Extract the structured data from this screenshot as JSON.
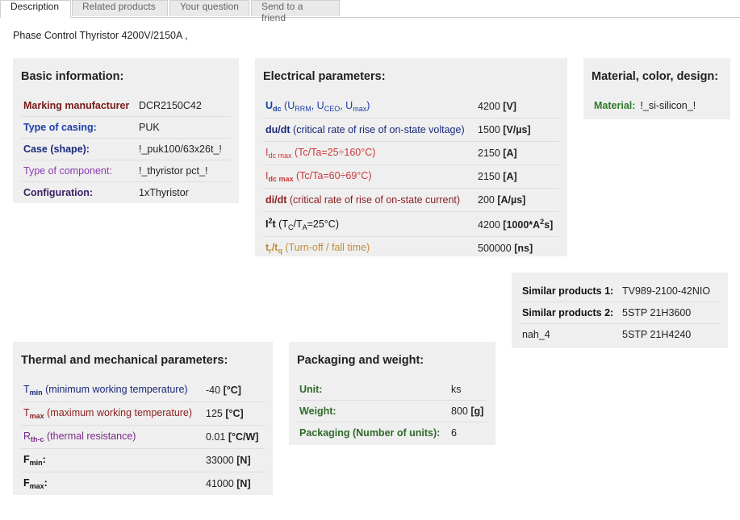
{
  "tabs": [
    "Description",
    "Related products",
    "Your question",
    "Send to a friend"
  ],
  "page_title": "Phase Control Thyristor 4200V/2150A ,",
  "basic": {
    "title": "Basic information:",
    "rows": [
      {
        "label": "Marking manufacturer",
        "value": "DCR2150C42"
      },
      {
        "label": "Type of casing:",
        "value": "PUK"
      },
      {
        "label": "Case (shape):",
        "value": "!_puk100/63x26t_!"
      },
      {
        "label": "Type of component:",
        "value": "!_thyristor pct_!"
      },
      {
        "label": "Configuration:",
        "value": "1xThyristor"
      }
    ]
  },
  "electrical": {
    "title": "Electrical parameters:",
    "rows": [
      {
        "sym": "U",
        "sub": "dc",
        "desc": "(U",
        "d1": "RRM",
        "d2": ", U",
        "d3": "CEO",
        "d4": ", U",
        "d5": "max",
        "d6": ")",
        "value": "4200",
        "unit": "[V]"
      },
      {
        "sym": "du/dt",
        "desc": "(critical rate of rise of on-state voltage)",
        "value": "1500",
        "unit": "[V/µs]"
      },
      {
        "sym": "I",
        "sub": "dc max",
        "desc": "(Tc/Ta=25÷160°C)",
        "value": "2150",
        "unit": "[A]"
      },
      {
        "sym": "I",
        "sub": "dc max",
        "desc": "(Tc/Ta=60÷69°C)",
        "value": "2150",
        "unit": "[A]"
      },
      {
        "sym": "di/dt",
        "desc": "(critical rate of rise of on-state current)",
        "value": "200",
        "unit": "[A/µs]"
      },
      {
        "sym": "I",
        "sup": "2",
        "sym2": "t",
        "desc": "(T",
        "d1": "C",
        "d2": "/T",
        "d3": "A",
        "d4": "=25°C)",
        "value": "4200",
        "unit_a": "[1000*A",
        "unit_sup": "2",
        "unit_b": "s]"
      },
      {
        "sym": "t",
        "sub": "r",
        "sym2": "/t",
        "sub2": "q",
        "desc": "(Turn-off / fall time)",
        "value": "500000",
        "unit": "[ns]"
      }
    ]
  },
  "material": {
    "title": "Material, color, design:",
    "label": "Material:",
    "value": "!_si-silicon_!"
  },
  "similar": {
    "rows": [
      {
        "label": "Similar products 1:",
        "value": "TV989-2100-42NIO"
      },
      {
        "label": "Similar products 2:",
        "value": "5STP 21H3600"
      },
      {
        "label": "nah_4",
        "value": "5STP 21H4240"
      }
    ]
  },
  "thermal": {
    "title": "Thermal and mechanical parameters:",
    "rows": [
      {
        "sym": "T",
        "sub": "min",
        "desc": "(minimum working temperature)",
        "value": "-40",
        "unit": "[°C]"
      },
      {
        "sym": "T",
        "sub": "max",
        "desc": "(maximum working temperature)",
        "value": "125",
        "unit": "[°C]"
      },
      {
        "sym": "R",
        "sub": "th-c",
        "desc": "(thermal resistance)",
        "value": "0.01",
        "unit": "[°C/W]"
      },
      {
        "sym": "F",
        "sub": "min",
        "suffix": ":",
        "value": "33000",
        "unit": "[N]"
      },
      {
        "sym": "F",
        "sub": "max",
        "suffix": ":",
        "value": "41000",
        "unit": "[N]"
      }
    ]
  },
  "packaging": {
    "title": "Packaging and weight:",
    "rows": [
      {
        "label": "Unit:",
        "value": "ks",
        "unit": ""
      },
      {
        "label": "Weight:",
        "value": "800",
        "unit": "[g]"
      },
      {
        "label": "Packaging (Number of units):",
        "value": "6",
        "unit": ""
      }
    ]
  }
}
